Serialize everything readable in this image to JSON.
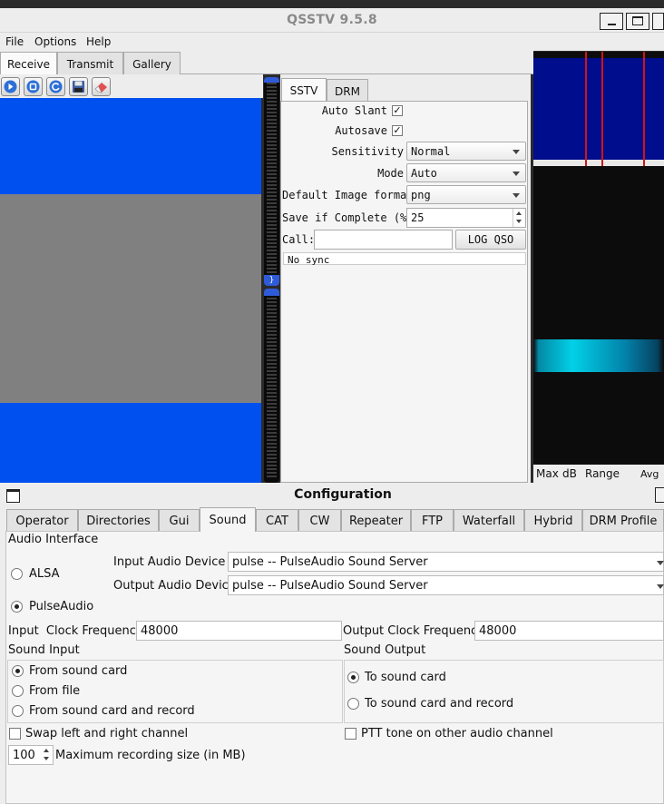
{
  "window": {
    "title": "QSSTV 9.5.8"
  },
  "menu": [
    "File",
    "Options",
    "Help"
  ],
  "main_tabs": [
    {
      "label": "Receive",
      "active": true
    },
    {
      "label": "Transmit",
      "active": false
    },
    {
      "label": "Gallery",
      "active": false
    }
  ],
  "toolbar_icons": [
    "start-icon",
    "stop-icon",
    "resync-icon",
    "save-icon",
    "erase-icon"
  ],
  "sstv": {
    "tabs": [
      {
        "label": "SSTV",
        "active": true
      },
      {
        "label": "DRM",
        "active": false
      }
    ],
    "auto_slant_label": "Auto Slant",
    "auto_slant_checked": true,
    "autosave_label": "Autosave",
    "autosave_checked": true,
    "sensitivity_label": "Sensitivity",
    "sensitivity_value": "Normal",
    "mode_label": "Mode",
    "mode_value": "Auto",
    "default_image_format_label": "Default Image format",
    "default_image_format_value": "png",
    "save_if_complete_label": "Save if Complete (%)",
    "save_if_complete_value": "25",
    "call_label": "Call:",
    "call_value": "",
    "log_qso_label": "LOG QSO",
    "status_text": "No sync"
  },
  "waterfall": {
    "footer_max_db": "Max",
    "footer_db": "dB",
    "footer_range": "Range",
    "footer_avg": "Avg"
  },
  "config": {
    "title": "Configuration",
    "tabs": [
      {
        "label": "Operator",
        "active": false
      },
      {
        "label": "Directories",
        "active": false
      },
      {
        "label": "Gui",
        "active": false
      },
      {
        "label": "Sound",
        "active": true
      },
      {
        "label": "CAT",
        "active": false
      },
      {
        "label": "CW",
        "active": false
      },
      {
        "label": "Repeater",
        "active": false
      },
      {
        "label": "FTP",
        "active": false
      },
      {
        "label": "Waterfall",
        "active": false
      },
      {
        "label": "Hybrid",
        "active": false
      },
      {
        "label": "DRM Profile",
        "active": false
      }
    ],
    "audio_interface_label": "Audio Interface",
    "alsa_label": "ALSA",
    "alsa_selected": false,
    "pulseaudio_label": "PulseAudio",
    "pulseaudio_selected": true,
    "input_audio_device_label": "Input Audio Device",
    "input_audio_device_value": "pulse -- PulseAudio Sound Server",
    "output_audio_device_label": "Output Audio Device",
    "output_audio_device_value": "pulse -- PulseAudio Sound Server",
    "input_clock_label": "Input  Clock Frequency",
    "input_clock_value": "48000",
    "output_clock_label": "Output Clock Frequency",
    "output_clock_value": "48000",
    "sound_input_label": "Sound Input",
    "sound_input_options": [
      {
        "label": "From sound card",
        "selected": true
      },
      {
        "label": "From file",
        "selected": false
      },
      {
        "label": "From sound card and record",
        "selected": false
      }
    ],
    "sound_output_label": "Sound Output",
    "sound_output_options": [
      {
        "label": "To sound card",
        "selected": true
      },
      {
        "label": "To sound card and record",
        "selected": false
      }
    ],
    "swap_channels_label": "Swap left and right channel",
    "swap_channels_checked": false,
    "ptt_tone_label": "PTT tone on other audio channel",
    "ptt_tone_checked": false,
    "max_recording_value": "100",
    "max_recording_label": "Maximum recording size (in MB)"
  }
}
